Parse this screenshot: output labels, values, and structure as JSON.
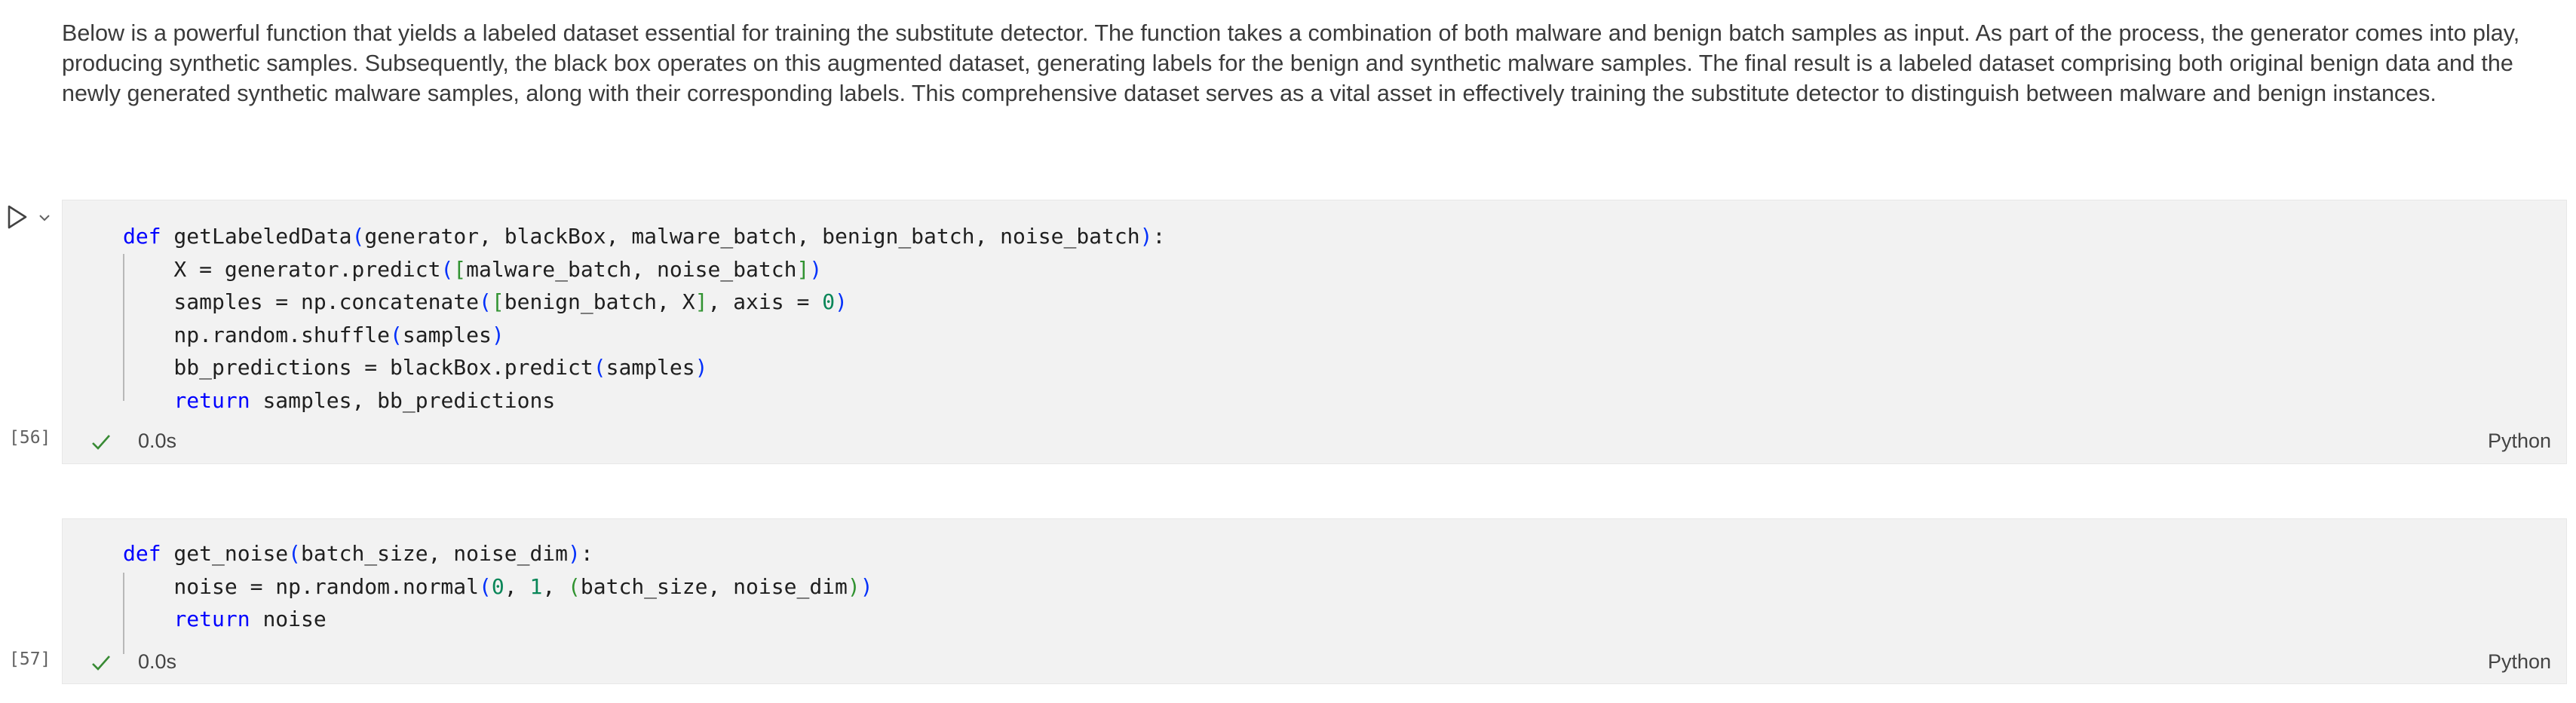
{
  "markdown": {
    "text": "Below is a powerful function that yields a labeled dataset essential for training the substitute detector. The function takes a combination of both malware and benign batch samples as input. As part of the process, the generator comes into play, producing synthetic samples. Subsequently, the black box operates on this augmented dataset, generating labels for the benign and synthetic malware samples. The final result is a labeled dataset comprising both original benign data and the newly generated synthetic malware samples, along with their corresponding labels. This comprehensive dataset serves as a vital asset in effectively training the substitute detector to distinguish between malware and benign instances."
  },
  "cells": [
    {
      "execution_count": "[56]",
      "status": "0.0s",
      "language": "Python",
      "lines": [
        [
          {
            "t": "def",
            "c": "kw"
          },
          {
            "t": " getLabeledData"
          },
          {
            "t": "(",
            "c": "br1"
          },
          {
            "t": "generator, blackBox, malware_batch, benign_batch, noise_batch"
          },
          {
            "t": ")",
            "c": "br1"
          },
          {
            "t": ":"
          }
        ],
        [
          {
            "t": "    X = generator.predict"
          },
          {
            "t": "(",
            "c": "br1"
          },
          {
            "t": "[",
            "c": "br2"
          },
          {
            "t": "malware_batch, noise_batch"
          },
          {
            "t": "]",
            "c": "br2"
          },
          {
            "t": ")",
            "c": "br1"
          }
        ],
        [
          {
            "t": "    samples = np.concatenate"
          },
          {
            "t": "(",
            "c": "br1"
          },
          {
            "t": "[",
            "c": "br2"
          },
          {
            "t": "benign_batch, X"
          },
          {
            "t": "]",
            "c": "br2"
          },
          {
            "t": ", axis = "
          },
          {
            "t": "0",
            "c": "num"
          },
          {
            "t": ")",
            "c": "br1"
          }
        ],
        [
          {
            "t": "    np.random.shuffle"
          },
          {
            "t": "(",
            "c": "br1"
          },
          {
            "t": "samples"
          },
          {
            "t": ")",
            "c": "br1"
          }
        ],
        [
          {
            "t": "    bb_predictions = blackBox.predict"
          },
          {
            "t": "(",
            "c": "br1"
          },
          {
            "t": "samples"
          },
          {
            "t": ")",
            "c": "br1"
          }
        ],
        [
          {
            "t": "    "
          },
          {
            "t": "return",
            "c": "kw2"
          },
          {
            "t": " samples, bb_predictions"
          }
        ]
      ]
    },
    {
      "execution_count": "[57]",
      "status": "0.0s",
      "language": "Python",
      "lines": [
        [
          {
            "t": "def",
            "c": "kw"
          },
          {
            "t": " get_noise"
          },
          {
            "t": "(",
            "c": "br1"
          },
          {
            "t": "batch_size, noise_dim"
          },
          {
            "t": ")",
            "c": "br1"
          },
          {
            "t": ":"
          }
        ],
        [
          {
            "t": "    noise = np.random.normal"
          },
          {
            "t": "(",
            "c": "br1"
          },
          {
            "t": "0",
            "c": "num"
          },
          {
            "t": ", "
          },
          {
            "t": "1",
            "c": "num"
          },
          {
            "t": ", "
          },
          {
            "t": "(",
            "c": "br2"
          },
          {
            "t": "batch_size, noise_dim"
          },
          {
            "t": ")",
            "c": "br2"
          },
          {
            "t": ")",
            "c": "br1"
          }
        ],
        [
          {
            "t": "    "
          },
          {
            "t": "return",
            "c": "kw2"
          },
          {
            "t": " noise"
          }
        ]
      ]
    }
  ],
  "icons": {
    "run": "play-icon",
    "collapse": "chevron-down-icon",
    "status": "check-icon"
  },
  "colors": {
    "keyword": "#0000ff",
    "number": "#098658",
    "bracket_level1": "#0431fa",
    "bracket_level2": "#319331",
    "success": "#388a34",
    "cell_background": "#f2f2f2"
  }
}
